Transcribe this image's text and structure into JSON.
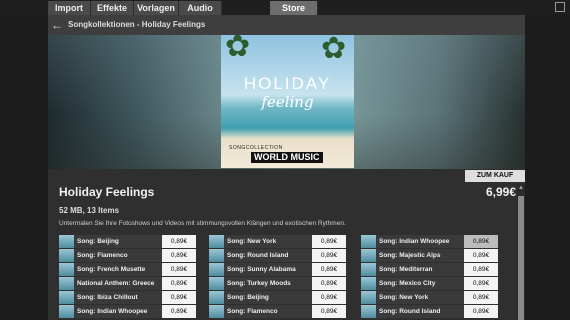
{
  "tabs": [
    {
      "label": "Import"
    },
    {
      "label": "Effekte"
    },
    {
      "label": "Vorlagen"
    },
    {
      "label": "Audio"
    },
    {
      "label": "Store"
    }
  ],
  "breadcrumb": "Songkollektionen - Holiday Feelings",
  "cover": {
    "title": "HOLIDAY",
    "subtitle": "feeling",
    "series": "SONGCOLLECTION",
    "genre": "WORLD MUSIC"
  },
  "buy_button": "ZUM KAUF",
  "collection": {
    "title": "Holiday Feelings",
    "price": "6,99€",
    "meta": "52 MB, 13 Items",
    "description": "Untermalen Sie Ihre Fotoshows und Videos mit stimmungsvollen Klängen und exotischen Rythmen."
  },
  "songs": [
    {
      "name": "Song: Beijing",
      "price": "0,89€"
    },
    {
      "name": "Song: Flamenco",
      "price": "0,89€"
    },
    {
      "name": "Song: French Musette",
      "price": "0,89€"
    },
    {
      "name": "National Anthem: Greece",
      "price": "0,89€"
    },
    {
      "name": "Song: Ibiza Chillout",
      "price": "0,89€"
    },
    {
      "name": "Song: Indian Whoopee",
      "price": "0,89€"
    },
    {
      "name": "Song: New York",
      "price": "0,89€"
    },
    {
      "name": "Song: Round Island",
      "price": "0,89€"
    },
    {
      "name": "Song: Sunny Alabama",
      "price": "0,89€"
    },
    {
      "name": "Song: Turkey Moods",
      "price": "0,89€"
    },
    {
      "name": "Song: Beijing",
      "price": "0,89€"
    },
    {
      "name": "Song: Flamenco",
      "price": "0,89€"
    },
    {
      "name": "Song: Indian Whoopee",
      "price": "0,89€"
    },
    {
      "name": "Song: Majestic Alps",
      "price": "0,89€"
    },
    {
      "name": "Song: Mediterran",
      "price": "0,89€"
    },
    {
      "name": "Song: Mexico City",
      "price": "0,89€"
    },
    {
      "name": "Song: New York",
      "price": "0,89€"
    },
    {
      "name": "Song: Round Island",
      "price": "0,89€"
    }
  ]
}
